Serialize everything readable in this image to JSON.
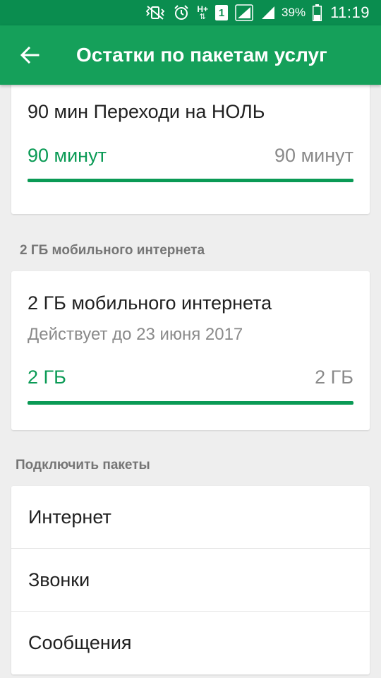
{
  "status_bar": {
    "network_type": "H+",
    "sim_badge": "1",
    "battery_percent": "39%",
    "battery_level": 0.39,
    "time": "11:19",
    "icons": [
      "vibrate-mute-icon",
      "alarm-clock-icon",
      "mobile-data-icon",
      "sim-1-icon",
      "signal-icon",
      "signal-icon",
      "battery-icon"
    ]
  },
  "app_bar": {
    "title": "Остатки по пакетам услуг",
    "back_icon": "arrow-left-icon"
  },
  "packages": [
    {
      "title": "90 мин Переходи на НОЛЬ",
      "remaining": "90 минут",
      "total": "90 минут",
      "fraction_remaining": 1.0
    }
  ],
  "internet_section": {
    "header": "2 ГБ мобильного интернета",
    "card": {
      "title": "2 ГБ мобильного интернета",
      "valid_until": "Действует до 23 июня 2017",
      "remaining": "2 ГБ",
      "total": "2 ГБ",
      "fraction_remaining": 1.0
    }
  },
  "connect_section": {
    "header": "Подключить пакеты",
    "items": [
      {
        "label": "Интернет"
      },
      {
        "label": "Звонки"
      },
      {
        "label": "Сообщения"
      }
    ]
  },
  "colors": {
    "status_bar": "#0a8d4f",
    "app_bar": "#15a05a",
    "accent": "#0a9a55",
    "background": "#eeeeee"
  }
}
